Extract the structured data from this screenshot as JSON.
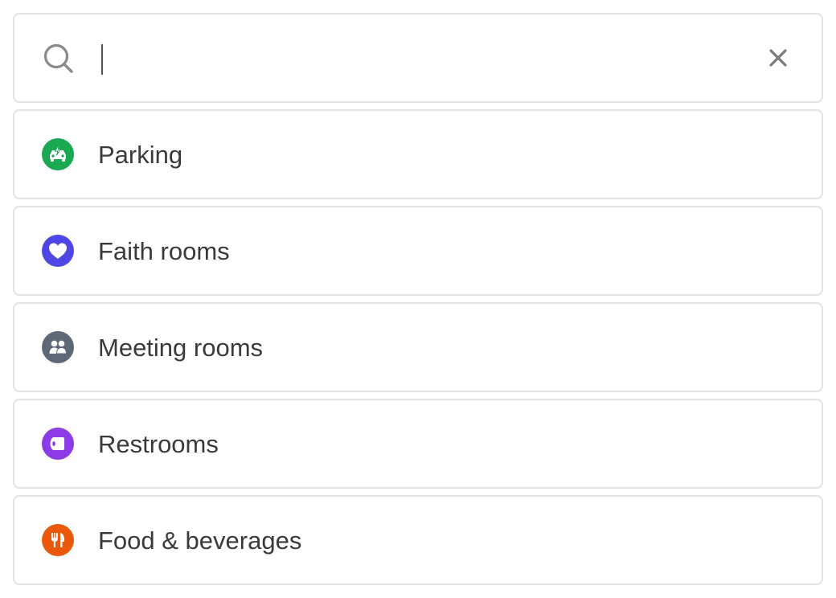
{
  "search": {
    "value": "",
    "icon": "search-icon",
    "clear_icon": "close-icon"
  },
  "categories": [
    {
      "label": "Parking",
      "icon": "ev-car-icon",
      "color": "#1aa850"
    },
    {
      "label": "Faith rooms",
      "icon": "heart-icon",
      "color": "#5046e5"
    },
    {
      "label": "Meeting rooms",
      "icon": "people-icon",
      "color": "#5f6877"
    },
    {
      "label": "Restrooms",
      "icon": "toilet-paper-icon",
      "color": "#8c3be6"
    },
    {
      "label": "Food & beverages",
      "icon": "utensils-icon",
      "color": "#ea580c"
    }
  ]
}
